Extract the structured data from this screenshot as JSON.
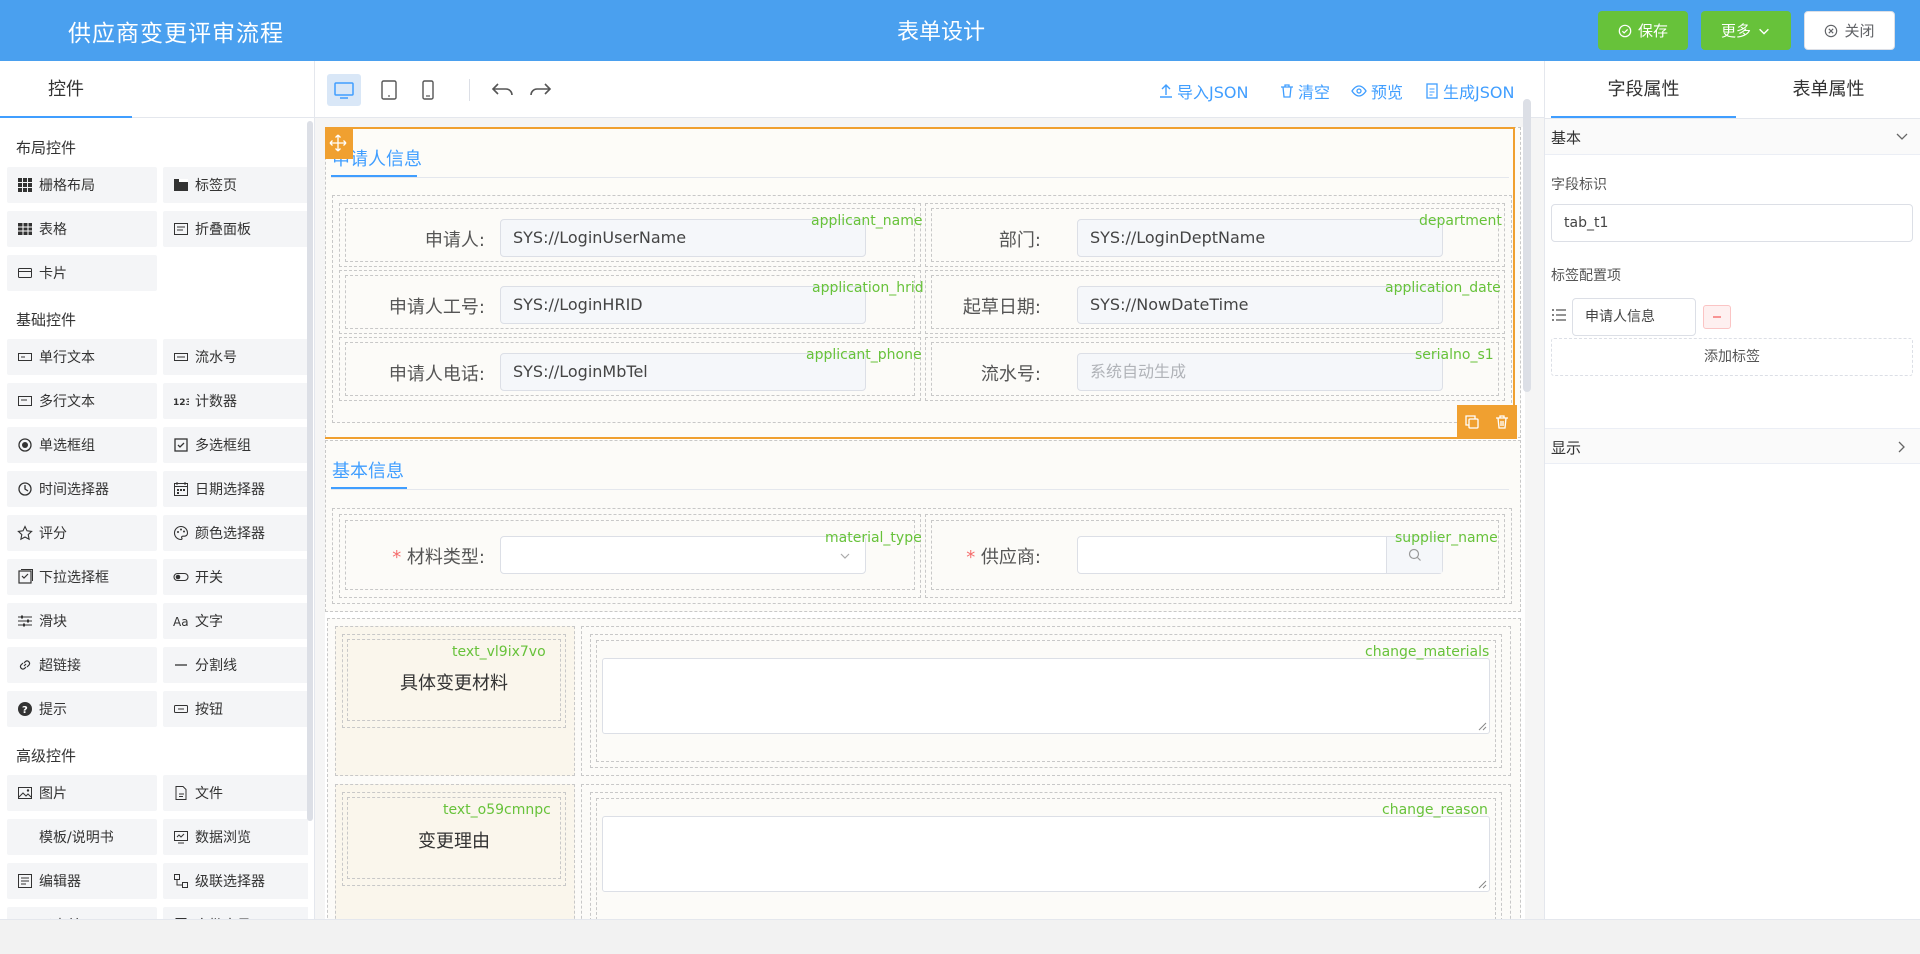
{
  "header": {
    "title": "供应商变更评审流程",
    "center": "表单设计",
    "save": "保存",
    "more": "更多",
    "close": "关闭"
  },
  "left": {
    "tab": "控件",
    "groups": [
      {
        "title": "布局控件",
        "items": [
          {
            "label": "栅格布局",
            "icon": "grid-icon"
          },
          {
            "label": "标签页",
            "icon": "tabs-icon"
          },
          {
            "label": "表格",
            "icon": "table-icon"
          },
          {
            "label": "折叠面板",
            "icon": "collapse-icon"
          },
          {
            "label": "卡片",
            "icon": "card-icon"
          }
        ]
      },
      {
        "title": "基础控件",
        "items": [
          {
            "label": "单行文本",
            "icon": "input-icon"
          },
          {
            "label": "流水号",
            "icon": "serial-icon"
          },
          {
            "label": "多行文本",
            "icon": "textarea-icon"
          },
          {
            "label": "计数器",
            "icon": "counter-icon"
          },
          {
            "label": "单选框组",
            "icon": "radio-icon"
          },
          {
            "label": "多选框组",
            "icon": "checkbox-icon"
          },
          {
            "label": "时间选择器",
            "icon": "clock-icon"
          },
          {
            "label": "日期选择器",
            "icon": "calendar-icon"
          },
          {
            "label": "评分",
            "icon": "star-icon"
          },
          {
            "label": "颜色选择器",
            "icon": "palette-icon"
          },
          {
            "label": "下拉选择框",
            "icon": "select-icon"
          },
          {
            "label": "开关",
            "icon": "switch-icon"
          },
          {
            "label": "滑块",
            "icon": "slider-icon"
          },
          {
            "label": "文字",
            "icon": "text-icon"
          },
          {
            "label": "超链接",
            "icon": "link-icon"
          },
          {
            "label": "分割线",
            "icon": "divider-icon"
          },
          {
            "label": "提示",
            "icon": "help-icon"
          },
          {
            "label": "按钮",
            "icon": "button-icon"
          }
        ]
      },
      {
        "title": "高级控件",
        "items": [
          {
            "label": "图片",
            "icon": "image-icon"
          },
          {
            "label": "文件",
            "icon": "file-icon"
          },
          {
            "label": "模板/说明书",
            "icon": "template-icon"
          },
          {
            "label": "数据浏览",
            "icon": "browse-icon"
          },
          {
            "label": "编辑器",
            "icon": "editor-icon"
          },
          {
            "label": "级联选择器",
            "icon": "cascader-icon"
          },
          {
            "label": "子表单",
            "icon": "subform-icon"
          },
          {
            "label": "审批意见",
            "icon": "approval-icon"
          }
        ]
      }
    ]
  },
  "toolbar": {
    "import": "导入JSON",
    "clear": "清空",
    "preview": "预览",
    "generate": "生成JSON"
  },
  "form": {
    "section1_title": "申请人信息",
    "section2_title": "基本信息",
    "rows": [
      {
        "l_label": "申请人:",
        "l_value": "SYS://LoginUserName",
        "l_field": "applicant_name",
        "r_label": "部门:",
        "r_value": "SYS://LoginDeptName",
        "r_field": "department"
      },
      {
        "l_label": "申请人工号:",
        "l_value": "SYS://LoginHRID",
        "l_field": "application_hrid",
        "r_label": "起草日期:",
        "r_value": "SYS://NowDateTime",
        "r_field": "application_date"
      },
      {
        "l_label": "申请人电话:",
        "l_value": "SYS://LoginMbTel",
        "l_field": "applicant_phone",
        "r_label": "流水号:",
        "r_value": "系统自动生成",
        "r_field": "serialno_s1"
      }
    ],
    "basic": {
      "l_req": "*",
      "l_label": "材料类型:",
      "l_field": "material_type",
      "r_req": "*",
      "r_label": "供应商:",
      "r_field": "supplier_name"
    },
    "table": [
      {
        "label": "具体变更材料",
        "text_field": "text_vl9ix7vo",
        "area_field": "change_materials"
      },
      {
        "label": "变更理由",
        "text_field": "text_o59cmnpc",
        "area_field": "change_reason"
      }
    ]
  },
  "right": {
    "tab_field": "字段属性",
    "tab_form": "表单属性",
    "basic": "基本",
    "field_id_label": "字段标识",
    "field_id_value": "tab_t1",
    "tab_config_label": "标签配置项",
    "tab_item_value": "申请人信息",
    "add_tab": "添加标签",
    "display": "显示"
  }
}
